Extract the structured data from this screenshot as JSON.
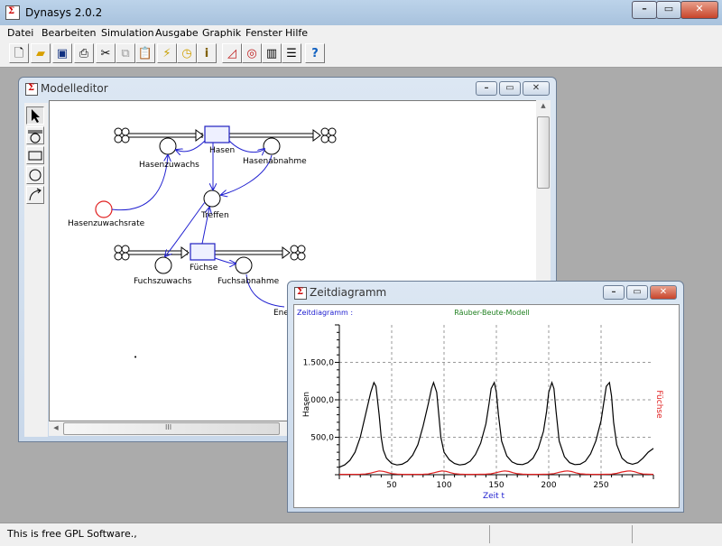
{
  "app": {
    "title": "Dynasys 2.0.2"
  },
  "menu": [
    "Datei",
    "Bearbeiten",
    "Simulation",
    "Ausgabe",
    "Graphik",
    "Fenster",
    "Hilfe"
  ],
  "toolbar": {
    "icons": [
      "new-file-icon",
      "open-folder-icon",
      "save-icon",
      "print-icon",
      "cut-icon",
      "copy-icon",
      "paste-icon",
      "run-icon",
      "clock-icon",
      "info-icon",
      "time-diagram-icon",
      "phase-diagram-icon",
      "table-icon",
      "list-icon",
      "help-icon"
    ]
  },
  "model_editor": {
    "title": "Modelleditor",
    "hscroll_grip": "III",
    "labels": {
      "hasen": "Hasen",
      "hasenzuwachs": "Hasenzuwachs",
      "hasenabnahme": "Hasenabnahme",
      "hasenzuwachsrate": "Hasenzuwachsrate",
      "treffen": "Treffen",
      "fuechse": "Füchse",
      "fuchszuwachs": "Fuchszuwachs",
      "fuchsabnahme": "Fuchsabnahme",
      "truncated": "Ene"
    },
    "colors": {
      "stock_border": "#2020c0",
      "stock_fill": "#eef0ff",
      "link": "#2020d0",
      "highlight": "#e02020"
    }
  },
  "time_diagram": {
    "title": "Zeitdiagramm",
    "header_left": "Zeitdiagramm :",
    "header_center": "Räuber-Beute-Modell"
  },
  "chart_data": {
    "type": "line",
    "title": "Räuber-Beute-Modell",
    "xlabel": "Zeit t",
    "ylabel": "Hasen",
    "y2label": "Füchse",
    "xlim": [
      0,
      300
    ],
    "ylim": [
      0,
      2000
    ],
    "x_ticks": [
      50,
      100,
      150,
      200,
      250
    ],
    "x_tick_labels": [
      "50",
      "100",
      "150",
      "200",
      "250"
    ],
    "y_ticks": [
      500,
      1000,
      1500
    ],
    "y_tick_labels": [
      "500,0",
      ",000,0",
      "1.500,0"
    ],
    "grid": true,
    "series": [
      {
        "name": "Hasen",
        "color": "#000000",
        "axis": "left",
        "x": [
          0,
          5,
          10,
          15,
          20,
          25,
          30,
          33,
          35,
          38,
          40,
          42,
          45,
          50,
          55,
          60,
          65,
          70,
          75,
          80,
          85,
          88,
          90,
          93,
          95,
          97,
          100,
          105,
          110,
          115,
          120,
          125,
          130,
          135,
          140,
          143,
          145,
          148,
          150,
          152,
          155,
          160,
          165,
          170,
          175,
          180,
          185,
          190,
          195,
          198,
          200,
          203,
          205,
          207,
          210,
          215,
          220,
          225,
          230,
          235,
          240,
          245,
          250,
          253,
          255,
          258,
          260,
          262,
          265,
          270,
          275,
          280,
          285,
          290,
          295,
          300
        ],
        "y": [
          100,
          130,
          190,
          300,
          500,
          800,
          1100,
          1230,
          1180,
          800,
          500,
          330,
          220,
          150,
          130,
          140,
          180,
          260,
          400,
          650,
          950,
          1150,
          1230,
          1100,
          800,
          500,
          300,
          200,
          150,
          130,
          140,
          180,
          270,
          420,
          680,
          950,
          1150,
          1230,
          1100,
          800,
          450,
          250,
          170,
          140,
          135,
          160,
          220,
          350,
          580,
          850,
          1100,
          1230,
          1150,
          850,
          450,
          240,
          160,
          135,
          140,
          180,
          280,
          450,
          720,
          1000,
          1180,
          1230,
          1050,
          700,
          400,
          220,
          160,
          140,
          160,
          220,
          300,
          350
        ]
      },
      {
        "name": "Füchse",
        "color": "#e02020",
        "axis": "right",
        "x": [
          0,
          10,
          20,
          25,
          30,
          35,
          38,
          42,
          46,
          50,
          55,
          60,
          70,
          80,
          85,
          90,
          95,
          98,
          102,
          106,
          110,
          115,
          120,
          130,
          140,
          145,
          150,
          155,
          158,
          162,
          166,
          170,
          175,
          180,
          190,
          200,
          205,
          210,
          215,
          218,
          222,
          226,
          230,
          235,
          240,
          250,
          260,
          265,
          270,
          275,
          278,
          282,
          286,
          290,
          300
        ],
        "y": [
          5,
          5,
          6,
          10,
          22,
          40,
          50,
          45,
          30,
          15,
          8,
          5,
          5,
          6,
          10,
          25,
          42,
          50,
          44,
          28,
          14,
          7,
          5,
          5,
          7,
          12,
          28,
          45,
          50,
          43,
          27,
          13,
          7,
          5,
          5,
          8,
          15,
          32,
          47,
          50,
          42,
          25,
          12,
          7,
          5,
          5,
          9,
          18,
          36,
          48,
          50,
          40,
          22,
          10,
          5
        ]
      }
    ]
  }
}
